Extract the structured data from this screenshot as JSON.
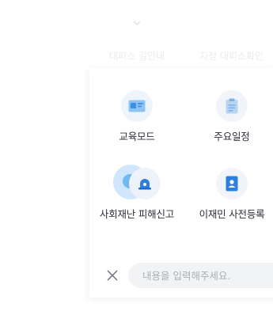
{
  "background": {
    "chevron_icon": "chevron-down-icon",
    "labels": [
      "대피소 길안내",
      "지정 대피소확인"
    ]
  },
  "menu": {
    "items": [
      {
        "label": "교육모드",
        "icon": "id-card-icon"
      },
      {
        "label": "주요일정",
        "icon": "clipboard-icon"
      },
      {
        "label": "사회재난 피해신고",
        "icon": "alarm-siren-icon"
      },
      {
        "label": "이재민 사전등록",
        "icon": "person-badge-icon"
      }
    ]
  },
  "input_bar": {
    "close_icon": "close-icon",
    "placeholder": "내용을 입력해주세요."
  },
  "colors": {
    "accent": "#3b82f6",
    "accent_light": "#cfe6fb",
    "text": "#2b2f36",
    "placeholder": "#a9aeb6",
    "input_bg": "#f2f3f5"
  }
}
